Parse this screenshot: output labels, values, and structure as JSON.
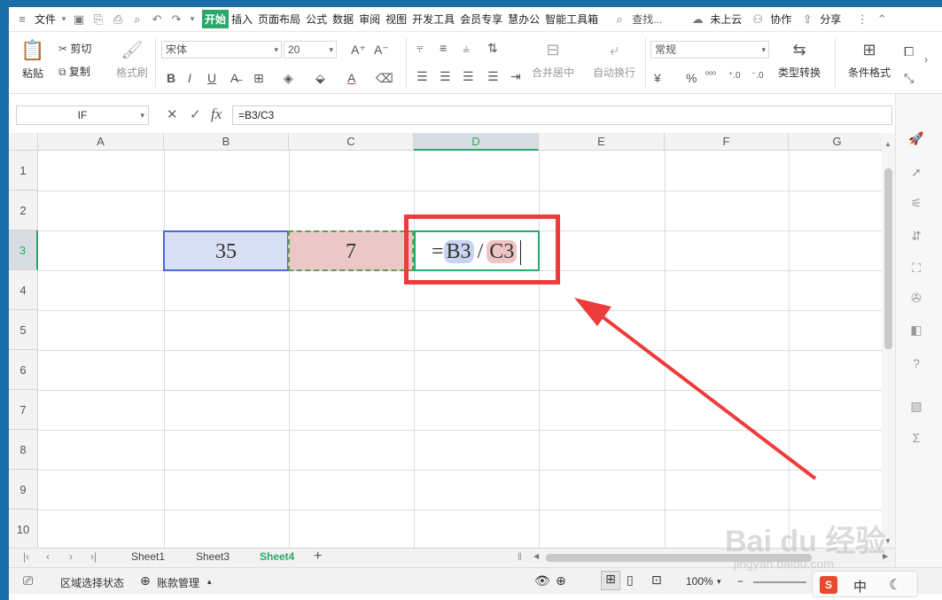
{
  "menubar": {
    "file": "文件",
    "tabs": [
      "开始",
      "插入",
      "页面布局",
      "公式",
      "数据",
      "审阅",
      "视图",
      "开发工具",
      "会员专享",
      "慧办公",
      "智能工具箱"
    ],
    "search": "查找...",
    "cloud": "未上云",
    "collab": "协作",
    "share": "分享"
  },
  "ribbon": {
    "paste": "粘贴",
    "cut": "剪切",
    "copy": "复制",
    "format_painter": "格式刷",
    "font_name": "宋体",
    "font_size": "20",
    "merge": "合并居中",
    "wrap": "自动换行",
    "number_format": "常规",
    "type_convert": "类型转换",
    "cond_format": "条件格式",
    "currency": "¥",
    "percent": "%"
  },
  "formula_bar": {
    "name_box": "IF",
    "formula": "=B3/C3",
    "fx": "fx"
  },
  "sheet": {
    "columns": [
      "A",
      "B",
      "C",
      "D",
      "E",
      "F",
      "G"
    ],
    "rows": [
      "1",
      "2",
      "3",
      "4",
      "5",
      "6",
      "7",
      "8",
      "9",
      "10"
    ],
    "b3": "35",
    "c3": "7",
    "d3_eq": "=",
    "d3_ref1": "B3",
    "d3_div": "/",
    "d3_ref2": "C3"
  },
  "tabs": {
    "sheets": [
      "Sheet1",
      "Sheet3",
      "Sheet4"
    ],
    "active": "Sheet4"
  },
  "status": {
    "mode": "区域选择状态",
    "ledger": "账款管理",
    "zoom": "100%"
  },
  "watermark": {
    "main": "Bai du 经验",
    "sub": "jingyan.baidu.com"
  },
  "ime": {
    "lang": "中"
  },
  "colors": {
    "accent": "#2aa86a",
    "b3_fill": "#dae0f3",
    "c3_fill": "#ebc7c7",
    "annotation": "#ee3b3b"
  }
}
